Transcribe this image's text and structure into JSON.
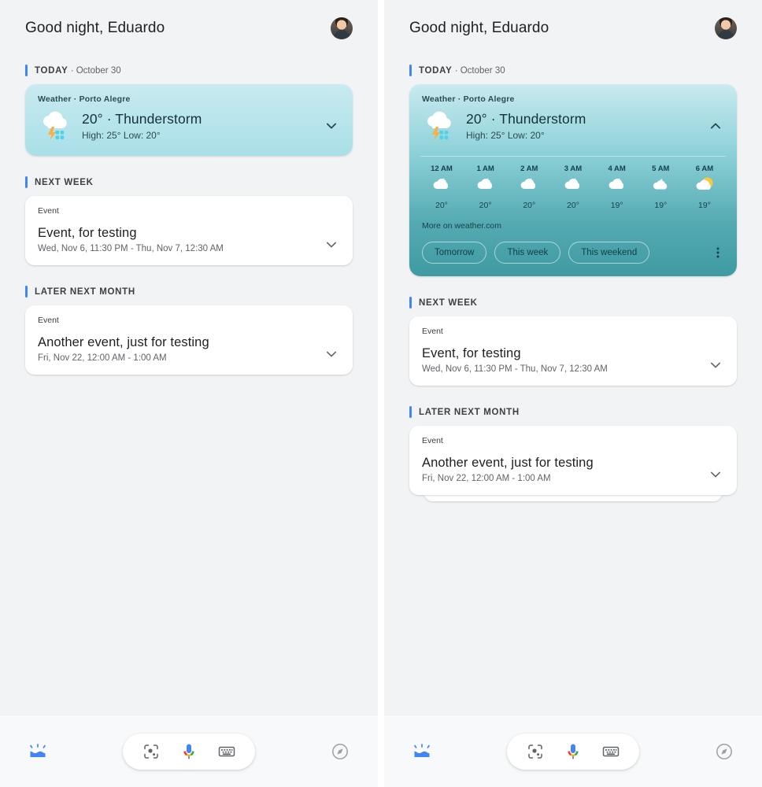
{
  "header": {
    "greeting": "Good night, Eduardo",
    "avatar_name": "user-avatar"
  },
  "sections": {
    "today": {
      "title": "TODAY",
      "separator": " · ",
      "date": "October 30"
    },
    "next_week": {
      "title": "NEXT WEEK"
    },
    "later_next_month": {
      "title": "LATER NEXT MONTH"
    }
  },
  "weather": {
    "label": "Weather · Porto Alegre",
    "temp_condition": "20° · Thunderstorm",
    "high_low": "High: 25° Low: 20°",
    "icon": "thunderstorm-icon",
    "collapsed_chevron": "chevron-down-icon",
    "expanded_chevron": "chevron-up-icon",
    "more_link": "More on weather.com",
    "chips": [
      "Tomorrow",
      "This week",
      "This weekend"
    ],
    "overflow": "kebab-menu-icon",
    "hourly": [
      {
        "time": "12 AM",
        "temp": "20°",
        "icon": "cloudy-night-icon"
      },
      {
        "time": "1 AM",
        "temp": "20°",
        "icon": "cloudy-night-icon"
      },
      {
        "time": "2 AM",
        "temp": "20°",
        "icon": "cloudy-night-icon"
      },
      {
        "time": "3 AM",
        "temp": "20°",
        "icon": "cloudy-night-icon"
      },
      {
        "time": "4 AM",
        "temp": "19°",
        "icon": "cloudy-night-icon"
      },
      {
        "time": "5 AM",
        "temp": "19°",
        "icon": "cloudy-night-icon"
      },
      {
        "time": "6 AM",
        "temp": "19°",
        "icon": "partly-sunny-icon"
      }
    ]
  },
  "events": {
    "next_week": {
      "kind": "Event",
      "title": "Event, for testing",
      "when": "Wed, Nov 6, 11:30 PM - Thu, Nov 7, 12:30 AM",
      "chevron": "chevron-down-icon"
    },
    "later_next_month": {
      "kind": "Event",
      "title": "Another event, just for testing",
      "when": "Fri, Nov 22, 12:00 AM - 1:00 AM",
      "chevron": "chevron-down-icon"
    }
  },
  "bottom_bar": {
    "collections_icon": "collections-crown-icon",
    "lens_icon": "google-lens-icon",
    "mic_icon": "google-microphone-icon",
    "keyboard_icon": "keyboard-icon",
    "discover_icon": "compass-icon"
  },
  "colors": {
    "accent_blue": "#4285f4",
    "weather_top": "#c9eaf0",
    "weather_bottom": "#3f9aa1",
    "page_bg": "#f1f3f4",
    "card_bg": "#ffffff"
  }
}
